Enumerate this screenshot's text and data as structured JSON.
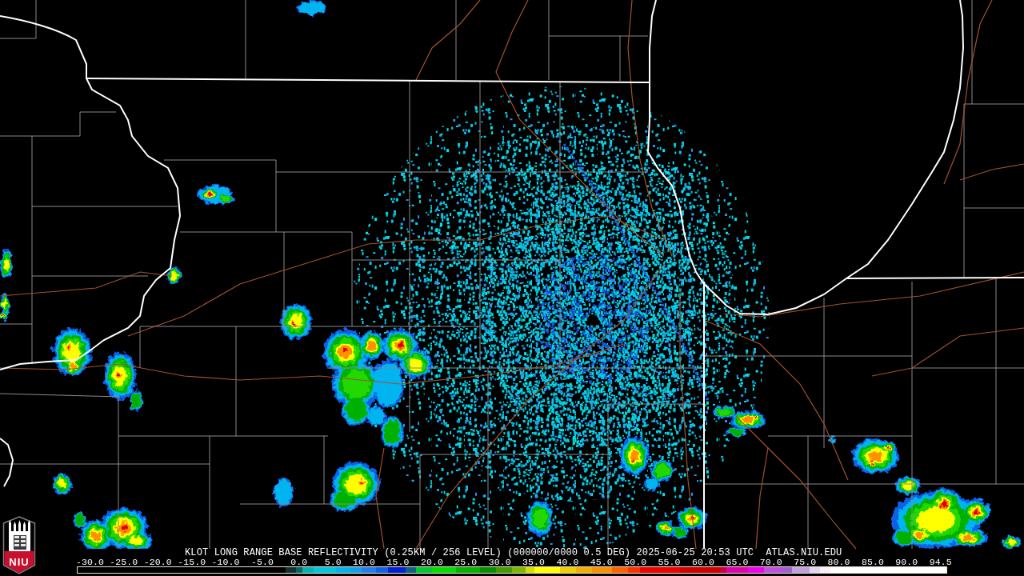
{
  "logo": {
    "text": "NIU"
  },
  "caption": {
    "title": "KLOT LONG RANGE BASE REFLECTIVITY (0.25KM / 256 LEVEL) (000000/0000 0.5 DEG) 2025-06-25 20:53 UTC",
    "source": "ATLAS.NIU.EDU"
  },
  "color_scale": {
    "labels": [
      "-30.0",
      "-25.0",
      "-20.0",
      "-15.0",
      "-10.0",
      "-5.0",
      "0.0",
      "5.0",
      "10.0",
      "15.0",
      "20.0",
      "25.0",
      "30.0",
      "35.0",
      "40.0",
      "45.0",
      "50.0",
      "55.0",
      "60.0",
      "65.0",
      "70.0",
      "75.0",
      "80.0",
      "85.0",
      "90.0",
      "94.5"
    ]
  }
}
